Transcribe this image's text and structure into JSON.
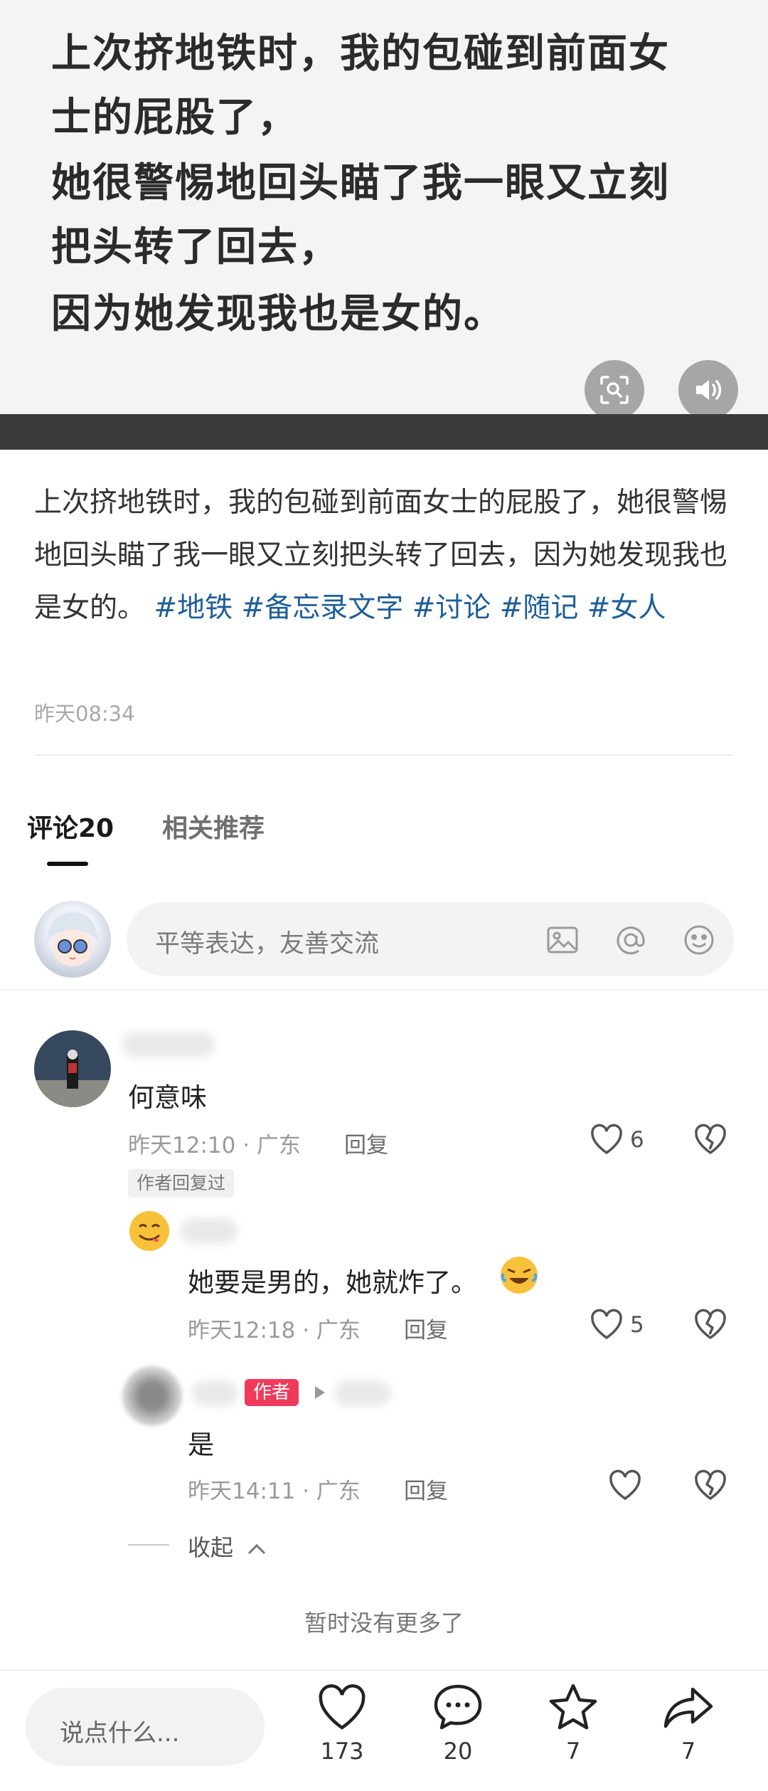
{
  "image_card": {
    "lines": [
      "上次挤地铁时，我的包碰到前面女",
      "士的屁股了，",
      "她很警惕地回头瞄了我一眼又立刻",
      "把头转了回去，",
      "因为她发现我也是女的。"
    ]
  },
  "post": {
    "text": "上次挤地铁时，我的包碰到前面女士的屁股了，她很警惕地回头瞄了我一眼又立刻把头转了回去，因为她发现我也是女的。",
    "hashtags": [
      "#地铁",
      "#备忘录文字",
      "#讨论",
      "#随记",
      "#女人"
    ],
    "time": "昨天08:34"
  },
  "tabs": {
    "comments": "评论20",
    "related": "相关推荐"
  },
  "comment_box": {
    "placeholder": "平等表达，友善交流"
  },
  "comments": [
    {
      "text": "何意味",
      "time": "昨天12:10 · 广东",
      "reply": "回复",
      "likes": "6",
      "badge": "作者回复过"
    },
    {
      "text": "她要是男的，她就炸了。",
      "time": "昨天12:18 · 广东",
      "reply": "回复",
      "likes": "5"
    },
    {
      "text": "是",
      "time": "昨天14:11 · 广东",
      "reply": "回复",
      "likes": "",
      "author_badge": "作者"
    }
  ],
  "collapse": "收起",
  "no_more": "暂时没有更多了",
  "bottom_bar": {
    "placeholder": "说点什么...",
    "likes": "173",
    "comments": "20",
    "favorites": "7",
    "shares": "7"
  },
  "colors": {
    "hashtag": "#1e5e96",
    "author_badge": "#f03a5b",
    "dark_band": "#3a3a3a"
  }
}
